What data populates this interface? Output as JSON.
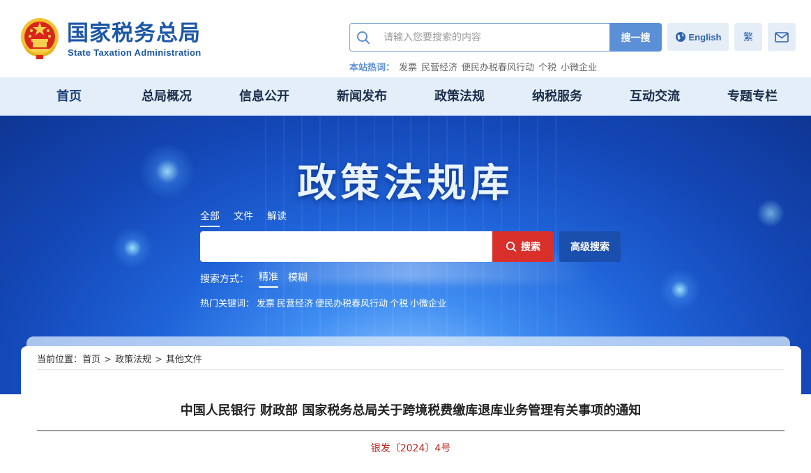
{
  "header": {
    "logo_cn": "国家税务总局",
    "logo_en": "State Taxation Administration",
    "search_placeholder": "请输入您要搜索的内容",
    "search_button": "搜一搜",
    "english_button": "English",
    "traditional_button": "繁",
    "hotwords_label": "本站热词：",
    "hotwords": [
      "发票",
      "民营经济",
      "便民办税春风行动",
      "个税",
      "小微企业"
    ]
  },
  "nav": {
    "items": [
      "首页",
      "总局概况",
      "信息公开",
      "新闻发布",
      "政策法规",
      "纳税服务",
      "互动交流",
      "专题专栏"
    ]
  },
  "banner": {
    "title": "政策法规库",
    "tabs": [
      "全部",
      "文件",
      "解读"
    ],
    "search_button": "搜索",
    "advanced_button": "高级搜索",
    "mode_label": "搜索方式：",
    "modes": [
      "精准",
      "模糊"
    ],
    "hot_label": "热门关键词：",
    "hot_keywords": [
      "发票",
      "民营经济",
      "便民办税春风行动",
      "个税",
      "小微企业"
    ]
  },
  "breadcrumb": {
    "label": "当前位置：",
    "items": [
      "首页",
      "政策法规",
      "其他文件"
    ],
    "separator": ">"
  },
  "document": {
    "title": "中国人民银行 财政部 国家税务总局关于跨境税费缴库退库业务管理有关事项的通知",
    "number": "银发〔2024〕4号"
  },
  "colors": {
    "brand_blue": "#1c57a8",
    "search_blue": "#5b8fd6",
    "nav_bg": "#e4eef9",
    "red_button": "#d9302c",
    "advanced_button": "#1b4fad",
    "doc_number_red": "#c0281f"
  },
  "icons": {
    "emblem": "national-emblem-icon",
    "search": "search-icon",
    "globe": "globe-icon",
    "mail": "mail-icon"
  }
}
